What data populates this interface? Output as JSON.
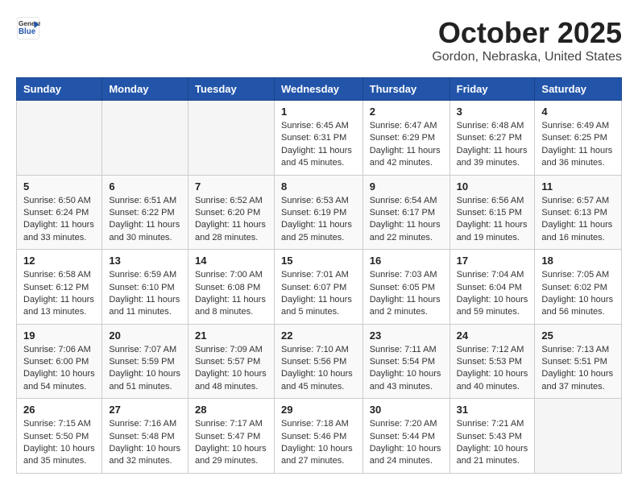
{
  "logo": {
    "general": "General",
    "blue": "Blue"
  },
  "header": {
    "month": "October 2025",
    "location": "Gordon, Nebraska, United States"
  },
  "weekdays": [
    "Sunday",
    "Monday",
    "Tuesday",
    "Wednesday",
    "Thursday",
    "Friday",
    "Saturday"
  ],
  "weeks": [
    [
      {
        "day": "",
        "info": ""
      },
      {
        "day": "",
        "info": ""
      },
      {
        "day": "",
        "info": ""
      },
      {
        "day": "1",
        "info": "Sunrise: 6:45 AM\nSunset: 6:31 PM\nDaylight: 11 hours\nand 45 minutes."
      },
      {
        "day": "2",
        "info": "Sunrise: 6:47 AM\nSunset: 6:29 PM\nDaylight: 11 hours\nand 42 minutes."
      },
      {
        "day": "3",
        "info": "Sunrise: 6:48 AM\nSunset: 6:27 PM\nDaylight: 11 hours\nand 39 minutes."
      },
      {
        "day": "4",
        "info": "Sunrise: 6:49 AM\nSunset: 6:25 PM\nDaylight: 11 hours\nand 36 minutes."
      }
    ],
    [
      {
        "day": "5",
        "info": "Sunrise: 6:50 AM\nSunset: 6:24 PM\nDaylight: 11 hours\nand 33 minutes."
      },
      {
        "day": "6",
        "info": "Sunrise: 6:51 AM\nSunset: 6:22 PM\nDaylight: 11 hours\nand 30 minutes."
      },
      {
        "day": "7",
        "info": "Sunrise: 6:52 AM\nSunset: 6:20 PM\nDaylight: 11 hours\nand 28 minutes."
      },
      {
        "day": "8",
        "info": "Sunrise: 6:53 AM\nSunset: 6:19 PM\nDaylight: 11 hours\nand 25 minutes."
      },
      {
        "day": "9",
        "info": "Sunrise: 6:54 AM\nSunset: 6:17 PM\nDaylight: 11 hours\nand 22 minutes."
      },
      {
        "day": "10",
        "info": "Sunrise: 6:56 AM\nSunset: 6:15 PM\nDaylight: 11 hours\nand 19 minutes."
      },
      {
        "day": "11",
        "info": "Sunrise: 6:57 AM\nSunset: 6:13 PM\nDaylight: 11 hours\nand 16 minutes."
      }
    ],
    [
      {
        "day": "12",
        "info": "Sunrise: 6:58 AM\nSunset: 6:12 PM\nDaylight: 11 hours\nand 13 minutes."
      },
      {
        "day": "13",
        "info": "Sunrise: 6:59 AM\nSunset: 6:10 PM\nDaylight: 11 hours\nand 11 minutes."
      },
      {
        "day": "14",
        "info": "Sunrise: 7:00 AM\nSunset: 6:08 PM\nDaylight: 11 hours\nand 8 minutes."
      },
      {
        "day": "15",
        "info": "Sunrise: 7:01 AM\nSunset: 6:07 PM\nDaylight: 11 hours\nand 5 minutes."
      },
      {
        "day": "16",
        "info": "Sunrise: 7:03 AM\nSunset: 6:05 PM\nDaylight: 11 hours\nand 2 minutes."
      },
      {
        "day": "17",
        "info": "Sunrise: 7:04 AM\nSunset: 6:04 PM\nDaylight: 10 hours\nand 59 minutes."
      },
      {
        "day": "18",
        "info": "Sunrise: 7:05 AM\nSunset: 6:02 PM\nDaylight: 10 hours\nand 56 minutes."
      }
    ],
    [
      {
        "day": "19",
        "info": "Sunrise: 7:06 AM\nSunset: 6:00 PM\nDaylight: 10 hours\nand 54 minutes."
      },
      {
        "day": "20",
        "info": "Sunrise: 7:07 AM\nSunset: 5:59 PM\nDaylight: 10 hours\nand 51 minutes."
      },
      {
        "day": "21",
        "info": "Sunrise: 7:09 AM\nSunset: 5:57 PM\nDaylight: 10 hours\nand 48 minutes."
      },
      {
        "day": "22",
        "info": "Sunrise: 7:10 AM\nSunset: 5:56 PM\nDaylight: 10 hours\nand 45 minutes."
      },
      {
        "day": "23",
        "info": "Sunrise: 7:11 AM\nSunset: 5:54 PM\nDaylight: 10 hours\nand 43 minutes."
      },
      {
        "day": "24",
        "info": "Sunrise: 7:12 AM\nSunset: 5:53 PM\nDaylight: 10 hours\nand 40 minutes."
      },
      {
        "day": "25",
        "info": "Sunrise: 7:13 AM\nSunset: 5:51 PM\nDaylight: 10 hours\nand 37 minutes."
      }
    ],
    [
      {
        "day": "26",
        "info": "Sunrise: 7:15 AM\nSunset: 5:50 PM\nDaylight: 10 hours\nand 35 minutes."
      },
      {
        "day": "27",
        "info": "Sunrise: 7:16 AM\nSunset: 5:48 PM\nDaylight: 10 hours\nand 32 minutes."
      },
      {
        "day": "28",
        "info": "Sunrise: 7:17 AM\nSunset: 5:47 PM\nDaylight: 10 hours\nand 29 minutes."
      },
      {
        "day": "29",
        "info": "Sunrise: 7:18 AM\nSunset: 5:46 PM\nDaylight: 10 hours\nand 27 minutes."
      },
      {
        "day": "30",
        "info": "Sunrise: 7:20 AM\nSunset: 5:44 PM\nDaylight: 10 hours\nand 24 minutes."
      },
      {
        "day": "31",
        "info": "Sunrise: 7:21 AM\nSunset: 5:43 PM\nDaylight: 10 hours\nand 21 minutes."
      },
      {
        "day": "",
        "info": ""
      }
    ]
  ]
}
